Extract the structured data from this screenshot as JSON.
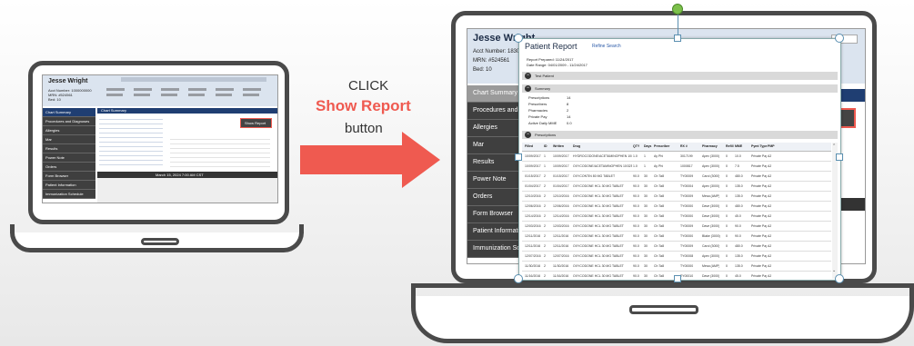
{
  "instruction": {
    "line1": "CLICK",
    "line2": "Show Report",
    "line3": "button"
  },
  "colors": {
    "accent": "#ef5a50",
    "sidebar": "#3f3f3f",
    "header_band": "#dbe4ef",
    "nav_blue": "#1f3e72"
  },
  "left_screen": {
    "patient_name": "Jesse Wright",
    "header_lines": [
      "Acct Number: 1000000000",
      "MRN: #524561",
      "Bed: 10"
    ],
    "sidebar": [
      "Chart Summary",
      "Procedures and Diagnoses",
      "Allergies",
      "Mar",
      "Results",
      "Power Note",
      "Orders",
      "Form Browser",
      "Patient Information",
      "Immunization Schedule"
    ],
    "panel_title": "Chart Summary",
    "show_report_label": "Show Report",
    "footer_date": "March 15, 2024 7:00 AM CST"
  },
  "right_screen": {
    "patient_name": "Jesse Wright",
    "acct_line": "Acct Number: 1830",
    "mrn_line": "MRN: #524561",
    "bed_line": "Bed: 10",
    "sidebar": [
      "Chart Summary",
      "Procedures and Dia",
      "Allergies",
      "Mar",
      "Results",
      "Power Note",
      "Orders",
      "Form Browser",
      "Patient Information",
      "Immunization Sche"
    ]
  },
  "report": {
    "title": "Patient Report",
    "refine_link": "Refine Search",
    "prepared_line": "Report Prepared: 11/24/2017",
    "range_line": "Date Range: 04/01/2009 - 11/24/2017",
    "sections": {
      "patient": "Test Patient",
      "summary": "Summary",
      "prescriptions": "Prescriptions"
    },
    "summary_rows": [
      {
        "label": "Prescriptions",
        "value": "14"
      },
      {
        "label": "Prescribers",
        "value": "8"
      },
      {
        "label": "Pharmacies",
        "value": "2"
      },
      {
        "label": "Private Pay",
        "value": "14"
      },
      {
        "label": "Active Daily MME",
        "value": "0.0"
      }
    ],
    "columns": [
      "Filled",
      "ID",
      "Written",
      "Drug",
      "QTY",
      "Days",
      "Prescriber",
      "RX #",
      "Pharmacy",
      "Refill",
      "MME",
      "Pymt Type",
      "PMP"
    ],
    "rows": [
      [
        "10/09/2017",
        "1",
        "10/09/2017",
        "HYDROCODONE/ACETAMINOPHEN 10/325",
        "1.0",
        "1",
        "Ay Phi",
        "3017199",
        "Apex (3000)",
        "0",
        "10.0",
        "Private Pay",
        "AZ"
      ],
      [
        "10/09/2017",
        "1",
        "10/09/2017",
        "OXYCODONE/ACETAMINOPHEN 10/325",
        "1.0",
        "1",
        "Ay Phi",
        "1000817",
        "Apex (3000)",
        "0",
        "7.5",
        "Private Pay",
        "AZ"
      ],
      [
        "01/15/2017",
        "2",
        "01/15/2017",
        "OXYCONTIN 80 MG TABLET",
        "90.0",
        "30",
        "Ch Ta8",
        "TY00009",
        "Carol (3000)",
        "0",
        "480.0",
        "Private Pay",
        "AZ"
      ],
      [
        "01/04/2017",
        "2",
        "01/04/2017",
        "OXYCODONE HCL 30 MG TABLET",
        "90.0",
        "30",
        "Ch Ta8",
        "TY00004",
        "Apex (3000)",
        "0",
        "135.0",
        "Private Pay",
        "AZ"
      ],
      [
        "12/10/2016",
        "2",
        "12/10/2016",
        "OXYCODONE HCL 30 MG TABLET",
        "90.0",
        "30",
        "Ch Ta8",
        "TY00009",
        "Mesa (AMP)",
        "0",
        "135.0",
        "Private Pay",
        "AZ"
      ],
      [
        "12/06/2016",
        "2",
        "12/06/2016",
        "OXYCODONE HCL 30 MG TABLET",
        "90.0",
        "30",
        "Ch Ta8",
        "TY00000",
        "Dave (3000)",
        "0",
        "480.0",
        "Private Pay",
        "AZ"
      ],
      [
        "12/14/2016",
        "2",
        "12/14/2016",
        "OXYCODONE HCL 30 MG TABLET",
        "90.0",
        "30",
        "Ch Ta8",
        "TY00000",
        "Dave (3000)",
        "0",
        "45.0",
        "Private Pay",
        "AZ"
      ],
      [
        "12/03/2016",
        "2",
        "12/03/2016",
        "OXYCODONE HCL 30 MG TABLET",
        "90.0",
        "30",
        "Ch Ta8",
        "TY00009",
        "Dave (3000)",
        "0",
        "90.0",
        "Private Pay",
        "AZ"
      ],
      [
        "12/11/2016",
        "2",
        "12/11/2016",
        "OXYCODONE HCL 30 MG TABLET",
        "90.0",
        "30",
        "Ch Ta8",
        "TY00000",
        "Blake (3000)",
        "0",
        "90.0",
        "Private Pay",
        "AZ"
      ],
      [
        "12/11/2016",
        "2",
        "12/11/2016",
        "OXYCODONE HCL 30 MG TABLET",
        "90.0",
        "30",
        "Ch Ta8",
        "TY00009",
        "Carol (3000)",
        "0",
        "480.0",
        "Private Pay",
        "AZ"
      ],
      [
        "12/07/2016",
        "2",
        "12/07/2016",
        "OXYCODONE HCL 30 MG TABLET",
        "90.0",
        "30",
        "Ch Ta8",
        "TY00008",
        "Apex (3000)",
        "0",
        "135.0",
        "Private Pay",
        "AZ"
      ],
      [
        "11/30/2016",
        "2",
        "11/30/2016",
        "OXYCODONE HCL 30 MG TABLET",
        "90.0",
        "30",
        "Ch Ta8",
        "TY00000",
        "Mesa (AMP)",
        "0",
        "135.0",
        "Private Pay",
        "AZ"
      ],
      [
        "11/16/2016",
        "2",
        "11/16/2016",
        "OXYCODONE HCL 30 MG TABLET",
        "90.0",
        "30",
        "Ch Ta8",
        "TY00010",
        "Dave (3000)",
        "0",
        "45.0",
        "Private Pay",
        "AZ"
      ]
    ]
  }
}
